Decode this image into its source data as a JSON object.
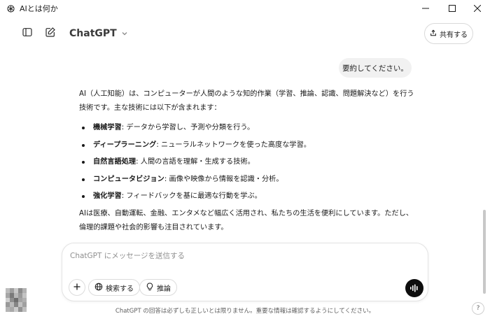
{
  "window": {
    "title": "AIとは何か"
  },
  "topbar": {
    "model_name": "ChatGPT",
    "share_label": "共有する"
  },
  "conversation": {
    "user_message": "要約してください。",
    "assistant": {
      "intro": "AI（人工知能）は、コンピューターが人間のような知的作業（学習、推論、認識、問題解決など）を行う技術です。主な技術には以下が含まれます：",
      "items": [
        {
          "term": "機械学習",
          "desc": ": データから学習し、予測や分類を行う。"
        },
        {
          "term": "ディープラーニング",
          "desc": ": ニューラルネットワークを使った高度な学習。"
        },
        {
          "term": "自然言語処理",
          "desc": ": 人間の言語を理解・生成する技術。"
        },
        {
          "term": "コンピュータビジョン",
          "desc": ": 画像や映像から情報を認識・分析。"
        },
        {
          "term": "強化学習",
          "desc": ": フィードバックを基に最適な行動を学ぶ。"
        }
      ],
      "conclusion": "AIは医療、自動運転、金融、エンタメなど幅広く活用され、私たちの生活を便利にしています。ただし、倫理的課題や社会的影響も注目されています。"
    }
  },
  "composer": {
    "placeholder": "ChatGPT にメッセージを送信する",
    "value": "",
    "search_label": "検索する",
    "reason_label": "推論"
  },
  "footer": {
    "disclaimer": "ChatGPT の回答は必ずしも正しいとは限りません。重要な情報は確認するようにしてください。",
    "help_label": "?"
  },
  "icons": {
    "app": "chatgpt-logo-icon",
    "sidebar": "sidebar-toggle-icon",
    "new_chat": "new-chat-icon",
    "share": "share-icon",
    "plus": "plus-icon",
    "search": "globe-icon",
    "reason": "lightbulb-icon",
    "voice": "voice-icon"
  },
  "colors": {
    "voice_button": "#0d0d0d",
    "user_bubble": "#f1f1f1"
  }
}
